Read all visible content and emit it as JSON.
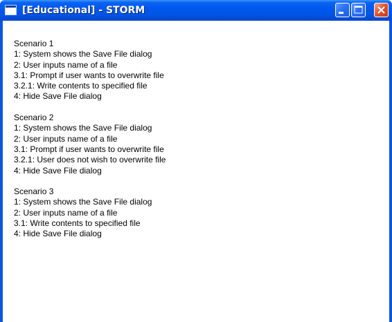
{
  "window": {
    "title": "[Educational] - STORM"
  },
  "icons": {
    "app": "window-app-icon",
    "minimize": "minimize-icon",
    "maximize": "maximize-icon",
    "close": "close-icon"
  },
  "colors": {
    "titlebar": "#0054e3",
    "close_button": "#e2512b",
    "background": "#ffffff"
  },
  "scenarios": [
    {
      "heading": "Scenario 1",
      "steps": [
        "1: System shows the Save File dialog",
        "2: User inputs name of a file",
        "3.1: Prompt if user wants to overwrite file",
        "3.2.1: Write contents to specified file",
        "4: Hide Save File dialog"
      ]
    },
    {
      "heading": "Scenario 2",
      "steps": [
        "1: System shows the Save File dialog",
        "2: User inputs name of a file",
        "3.1: Prompt if user wants to overwrite file",
        "3.2.1: User does not wish to overwrite file",
        "4: Hide Save File dialog"
      ]
    },
    {
      "heading": "Scenario 3",
      "steps": [
        "1: System shows the Save File dialog",
        "2: User inputs name of a file",
        "3.1: Write contents to specified file",
        "4: Hide Save File dialog"
      ]
    }
  ]
}
